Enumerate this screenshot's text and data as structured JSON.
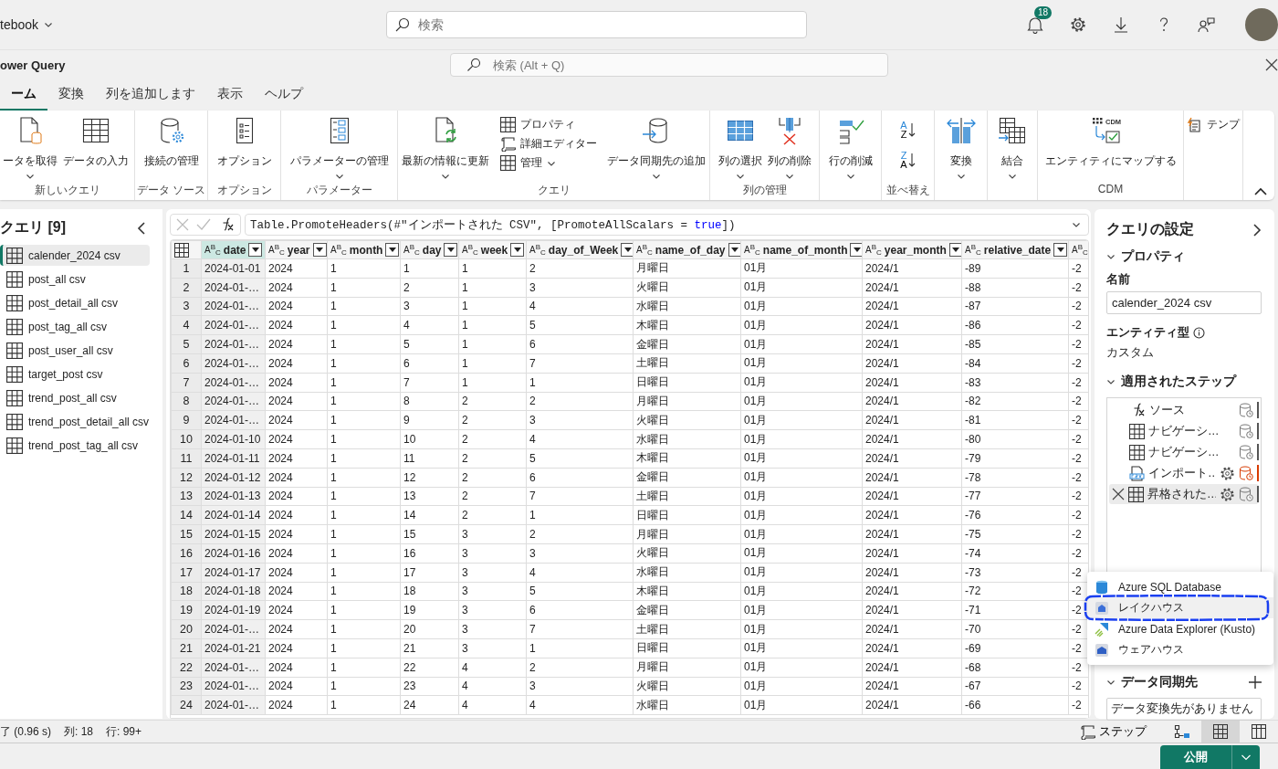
{
  "top_bar": {
    "workspace": "tebook",
    "search": {
      "placeholder": "検索"
    },
    "notification_count": "18"
  },
  "power_query": {
    "title": "ower Query",
    "search": {
      "placeholder": "検索 (Alt + Q)"
    }
  },
  "tabs": [
    {
      "label": "ーム",
      "selected": true
    },
    {
      "label": "変換",
      "selected": false
    },
    {
      "label": "列を追加します",
      "selected": false
    },
    {
      "label": "表示",
      "selected": false
    },
    {
      "label": "ヘルプ",
      "selected": false
    }
  ],
  "ribbon": {
    "groups": [
      {
        "label": "新しいクエリ",
        "buttons": [
          {
            "kind": "large",
            "label": "ータを取得",
            "dropdown": true
          },
          {
            "kind": "large",
            "label": "データの入力",
            "dropdown": false
          }
        ]
      },
      {
        "label": "データ ソース",
        "buttons": [
          {
            "kind": "large",
            "label": "接続の管理",
            "dropdown": false
          }
        ]
      },
      {
        "label": "オプション",
        "buttons": [
          {
            "kind": "large",
            "label": "オプション",
            "dropdown": false
          }
        ]
      },
      {
        "label": "パラメーター",
        "buttons": [
          {
            "kind": "large",
            "label": "パラメーターの管理",
            "dropdown": true
          }
        ]
      },
      {
        "label": "クエリ",
        "buttons": [
          {
            "kind": "large",
            "label": "最新の情報に更新",
            "dropdown": true
          },
          {
            "kind": "small",
            "label": "プロパティ",
            "dropdown": false
          },
          {
            "kind": "small",
            "label": "詳細エディター",
            "dropdown": false
          },
          {
            "kind": "small",
            "label": "管理",
            "dropdown": true
          },
          {
            "kind": "large",
            "label": "データ同期先の追加",
            "dropdown": true
          }
        ]
      },
      {
        "label": "列の管理",
        "buttons": [
          {
            "kind": "large",
            "label": "列の選択",
            "dropdown": true
          },
          {
            "kind": "large",
            "label": "列の削除",
            "dropdown": true
          }
        ]
      },
      {
        "buttons": [
          {
            "kind": "large",
            "label": "行の削減",
            "dropdown": true
          }
        ]
      },
      {
        "label": "並べ替え",
        "buttons": [
          {
            "kind": "sort",
            "top": "A",
            "bottom": "Z"
          },
          {
            "kind": "sort",
            "top": "Z",
            "bottom": "A"
          }
        ]
      },
      {
        "buttons": [
          {
            "kind": "large",
            "label": "変換",
            "dropdown": true
          }
        ]
      },
      {
        "buttons": [
          {
            "kind": "large",
            "label": "結合",
            "dropdown": true
          }
        ]
      },
      {
        "label": "CDM",
        "buttons": [
          {
            "kind": "large",
            "label": "エンティティにマップする",
            "dropdown": false,
            "icon_text": "CDM"
          }
        ]
      },
      {
        "buttons": [
          {
            "kind": "small",
            "label": "テンプ",
            "dropdown": false
          }
        ]
      }
    ]
  },
  "queries": {
    "title": "クエリ [9]",
    "items": [
      {
        "label": "calender_2024 csv",
        "selected": true
      },
      {
        "label": "post_all csv",
        "selected": false
      },
      {
        "label": "post_detail_all csv",
        "selected": false
      },
      {
        "label": "post_tag_all csv",
        "selected": false
      },
      {
        "label": "post_user_all csv",
        "selected": false
      },
      {
        "label": "target_post csv",
        "selected": false
      },
      {
        "label": "trend_post_all csv",
        "selected": false
      },
      {
        "label": "trend_post_detail_all csv",
        "selected": false
      },
      {
        "label": "trend_post_tag_all csv",
        "selected": false
      }
    ]
  },
  "formula_bar": {
    "parts": [
      {
        "kind": "code",
        "text": "Table.PromoteHeaders(#\"インポートされた CSV\", [PromoteAllScalars = "
      },
      {
        "kind": "keyword",
        "text": "true"
      },
      {
        "kind": "code",
        "text": "])"
      }
    ]
  },
  "table": {
    "columns": [
      {
        "type": "A$^{B}$$_{C}$",
        "label": "date",
        "selected": true
      },
      {
        "type": "A$^{B}$$_{C}$",
        "label": "year",
        "selected": false
      },
      {
        "type": "A$^{B}$$_{C}$",
        "label": "month",
        "selected": false
      },
      {
        "type": "A$^{B}$$_{C}$",
        "label": "day",
        "selected": false
      },
      {
        "type": "A$^{B}$$_{C}$",
        "label": "week",
        "selected": false
      },
      {
        "type": "A$^{B}$$_{C}$",
        "label": "day_of_Week",
        "selected": false
      },
      {
        "type": "A$^{B}$$_{C}$",
        "label": "name_of_day",
        "selected": false
      },
      {
        "type": "A$^{B}$$_{C}$",
        "label": "name_of_month",
        "selected": false
      },
      {
        "type": "A$^{B}$$_{C}$",
        "label": "year_month",
        "selected": false
      },
      {
        "type": "A$^{B}$$_{C}$",
        "label": "relative_date",
        "selected": false
      },
      {
        "type": "A$^{B}$$_{C}$",
        "selected": false
      }
    ],
    "rows": [
      {
        "number": "1",
        "cells": [
          "2024-01-01",
          "2024",
          "1",
          "1",
          "1",
          "2",
          "月曜日",
          "01月",
          "2024/1",
          "-89",
          "-2"
        ]
      },
      {
        "number": "2",
        "cells": [
          "2024-01-…",
          "2024",
          "1",
          "2",
          "1",
          "3",
          "火曜日",
          "01月",
          "2024/1",
          "-88",
          "-2"
        ]
      },
      {
        "number": "3",
        "cells": [
          "2024-01-…",
          "2024",
          "1",
          "3",
          "1",
          "4",
          "水曜日",
          "01月",
          "2024/1",
          "-87",
          "-2"
        ]
      },
      {
        "number": "4",
        "cells": [
          "2024-01-…",
          "2024",
          "1",
          "4",
          "1",
          "5",
          "木曜日",
          "01月",
          "2024/1",
          "-86",
          "-2"
        ]
      },
      {
        "number": "5",
        "cells": [
          "2024-01-…",
          "2024",
          "1",
          "5",
          "1",
          "6",
          "金曜日",
          "01月",
          "2024/1",
          "-85",
          "-2"
        ]
      },
      {
        "number": "6",
        "cells": [
          "2024-01-…",
          "2024",
          "1",
          "6",
          "1",
          "7",
          "土曜日",
          "01月",
          "2024/1",
          "-84",
          "-2"
        ]
      },
      {
        "number": "7",
        "cells": [
          "2024-01-…",
          "2024",
          "1",
          "7",
          "1",
          "1",
          "日曜日",
          "01月",
          "2024/1",
          "-83",
          "-2"
        ]
      },
      {
        "number": "8",
        "cells": [
          "2024-01-…",
          "2024",
          "1",
          "8",
          "2",
          "2",
          "月曜日",
          "01月",
          "2024/1",
          "-82",
          "-2"
        ]
      },
      {
        "number": "9",
        "cells": [
          "2024-01-…",
          "2024",
          "1",
          "9",
          "2",
          "3",
          "火曜日",
          "01月",
          "2024/1",
          "-81",
          "-2"
        ]
      },
      {
        "number": "10",
        "cells": [
          "2024-01-10",
          "2024",
          "1",
          "10",
          "2",
          "4",
          "水曜日",
          "01月",
          "2024/1",
          "-80",
          "-2"
        ]
      },
      {
        "number": "11",
        "cells": [
          "2024-01-11",
          "2024",
          "1",
          "11",
          "2",
          "5",
          "木曜日",
          "01月",
          "2024/1",
          "-79",
          "-2"
        ]
      },
      {
        "number": "12",
        "cells": [
          "2024-01-12",
          "2024",
          "1",
          "12",
          "2",
          "6",
          "金曜日",
          "01月",
          "2024/1",
          "-78",
          "-2"
        ]
      },
      {
        "number": "13",
        "cells": [
          "2024-01-13",
          "2024",
          "1",
          "13",
          "2",
          "7",
          "土曜日",
          "01月",
          "2024/1",
          "-77",
          "-2"
        ]
      },
      {
        "number": "14",
        "cells": [
          "2024-01-14",
          "2024",
          "1",
          "14",
          "2",
          "1",
          "日曜日",
          "01月",
          "2024/1",
          "-76",
          "-2"
        ]
      },
      {
        "number": "15",
        "cells": [
          "2024-01-15",
          "2024",
          "1",
          "15",
          "3",
          "2",
          "月曜日",
          "01月",
          "2024/1",
          "-75",
          "-2"
        ]
      },
      {
        "number": "16",
        "cells": [
          "2024-01-16",
          "2024",
          "1",
          "16",
          "3",
          "3",
          "火曜日",
          "01月",
          "2024/1",
          "-74",
          "-2"
        ]
      },
      {
        "number": "17",
        "cells": [
          "2024-01-17",
          "2024",
          "1",
          "17",
          "3",
          "4",
          "水曜日",
          "01月",
          "2024/1",
          "-73",
          "-2"
        ]
      },
      {
        "number": "18",
        "cells": [
          "2024-01-18",
          "2024",
          "1",
          "18",
          "3",
          "5",
          "木曜日",
          "01月",
          "2024/1",
          "-72",
          "-2"
        ]
      },
      {
        "number": "19",
        "cells": [
          "2024-01-19",
          "2024",
          "1",
          "19",
          "3",
          "6",
          "金曜日",
          "01月",
          "2024/1",
          "-71",
          "-2"
        ]
      },
      {
        "number": "20",
        "cells": [
          "2024-01-…",
          "2024",
          "1",
          "20",
          "3",
          "7",
          "土曜日",
          "01月",
          "2024/1",
          "-70",
          "-2"
        ]
      },
      {
        "number": "21",
        "cells": [
          "2024-01-21",
          "2024",
          "1",
          "21",
          "3",
          "1",
          "日曜日",
          "01月",
          "2024/1",
          "-69",
          "-2"
        ]
      },
      {
        "number": "22",
        "cells": [
          "2024-01-…",
          "2024",
          "1",
          "22",
          "4",
          "2",
          "月曜日",
          "01月",
          "2024/1",
          "-68",
          "-2"
        ]
      },
      {
        "number": "23",
        "cells": [
          "2024-01-…",
          "2024",
          "1",
          "23",
          "4",
          "3",
          "火曜日",
          "01月",
          "2024/1",
          "-67",
          "-2"
        ]
      },
      {
        "number": "24",
        "cells": [
          "2024-01-…",
          "2024",
          "1",
          "24",
          "4",
          "4",
          "水曜日",
          "01月",
          "2024/1",
          "-66",
          "-2"
        ]
      }
    ]
  },
  "settings": {
    "title": "クエリの設定",
    "properties": {
      "heading": "プロパティ",
      "name_label": "名前",
      "name_value": "calender_2024 csv",
      "entity_label": "エンティティ型",
      "entity_value": "カスタム"
    },
    "steps": {
      "heading": "適用されたステップ",
      "items": [
        {
          "kind": "formula",
          "label": "ソース",
          "selected": false,
          "has_settings": false,
          "warning": false
        },
        {
          "kind": "table",
          "label": "ナビゲーシ…",
          "selected": false,
          "has_settings": false,
          "warning": false
        },
        {
          "kind": "table",
          "label": "ナビゲーシ…",
          "selected": false,
          "has_settings": false,
          "warning": false
        },
        {
          "kind": "csv",
          "label": "インポート…",
          "selected": false,
          "has_settings": true,
          "warning": true
        },
        {
          "kind": "table",
          "label": "昇格された…",
          "selected": true,
          "has_settings": true,
          "warning": false
        }
      ]
    },
    "destination_menu": {
      "items": [
        {
          "label": "Azure SQL Database",
          "selected": false,
          "circled": false
        },
        {
          "label": "レイクハウス",
          "selected": true,
          "circled": true
        },
        {
          "label": "Azure Data Explorer (Kusto)",
          "selected": false,
          "circled": false
        },
        {
          "label": "ウェアハウス",
          "selected": false,
          "circled": false
        }
      ]
    },
    "destination": {
      "heading": "データ同期先",
      "value": "データ変換先がありません"
    }
  },
  "status_bar": {
    "texts": [
      "了 (0.96 s)",
      "列: 18",
      "行: 99+"
    ],
    "steps_button": "ステップ",
    "views": [
      {
        "selected": false
      },
      {
        "selected": true
      },
      {
        "selected": false
      }
    ]
  },
  "publish": {
    "label": "公開"
  }
}
